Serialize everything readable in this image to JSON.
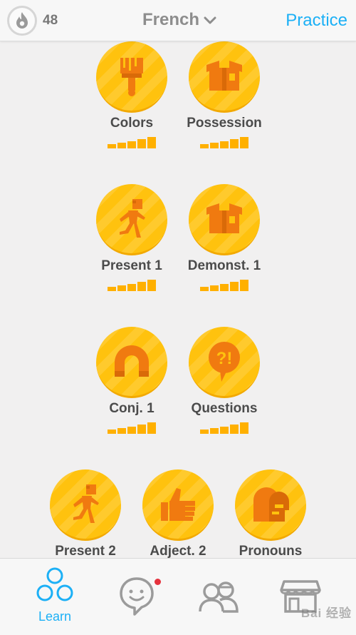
{
  "header": {
    "streak_count": "48",
    "language": "French",
    "practice_label": "Practice"
  },
  "skills": [
    {
      "label": "Colors",
      "icon": "paintbrush-icon"
    },
    {
      "label": "Possession",
      "icon": "box-icon"
    },
    {
      "label": "Present 1",
      "icon": "running-person-icon"
    },
    {
      "label": "Demonst. 1",
      "icon": "box-icon"
    },
    {
      "label": "Conj. 1",
      "icon": "magnet-icon"
    },
    {
      "label": "Questions",
      "icon": "speech-bubble-question-icon"
    },
    {
      "label": "Present 2",
      "icon": "running-person-icon"
    },
    {
      "label": "Adject. 2",
      "icon": "thumbs-up-icon"
    },
    {
      "label": "Pronouns",
      "icon": "face-silhouette-icon"
    }
  ],
  "bottom_nav": {
    "learn_label": "Learn",
    "items": [
      "learn-icon",
      "chat-icon",
      "friends-icon",
      "store-icon"
    ]
  },
  "watermark": "Bai 经验",
  "colors": {
    "accent_blue": "#1cb0f6",
    "skill_gold": "#ffc20e",
    "skill_icon": "#f07a10",
    "notification_red": "#e5323d"
  }
}
